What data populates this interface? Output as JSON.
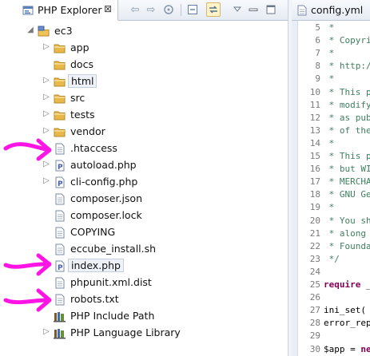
{
  "explorer": {
    "tab_title": "PHP Explorer",
    "close_glyph": "⊠",
    "toolbar_icons": [
      "back-icon",
      "forward-icon",
      "home-icon",
      "collapse-all-icon",
      "link-with-editor-icon",
      "view-menu-icon",
      "minimize-icon",
      "maximize-icon"
    ]
  },
  "tree": {
    "root": "ec3",
    "items": [
      {
        "label": "app",
        "kind": "folder"
      },
      {
        "label": "docs",
        "kind": "folder"
      },
      {
        "label": "html",
        "kind": "folder"
      },
      {
        "label": "src",
        "kind": "folder"
      },
      {
        "label": "tests",
        "kind": "folder"
      },
      {
        "label": "vendor",
        "kind": "folder"
      },
      {
        "label": ".htaccess",
        "kind": "file"
      },
      {
        "label": "autoload.php",
        "kind": "php"
      },
      {
        "label": "cli-config.php",
        "kind": "php"
      },
      {
        "label": "composer.json",
        "kind": "file"
      },
      {
        "label": "composer.lock",
        "kind": "file"
      },
      {
        "label": "COPYING",
        "kind": "file"
      },
      {
        "label": "eccube_install.sh",
        "kind": "file"
      },
      {
        "label": "index.php",
        "kind": "php"
      },
      {
        "label": "phpunit.xml.dist",
        "kind": "file"
      },
      {
        "label": "robots.txt",
        "kind": "file"
      },
      {
        "label": "PHP Include Path",
        "kind": "library"
      },
      {
        "label": "PHP Language Library",
        "kind": "library"
      }
    ]
  },
  "editor": {
    "tab_title": "config.yml",
    "lines": [
      {
        "n": "5",
        "text": " *",
        "type": "comment"
      },
      {
        "n": "6",
        "text": " * Copyri",
        "type": "comment"
      },
      {
        "n": "7",
        "text": " *",
        "type": "comment"
      },
      {
        "n": "8",
        "text": " * http:/",
        "type": "comment"
      },
      {
        "n": "9",
        "text": " *",
        "type": "comment"
      },
      {
        "n": "10",
        "text": " * This p",
        "type": "comment"
      },
      {
        "n": "11",
        "text": " * modify",
        "type": "comment"
      },
      {
        "n": "12",
        "text": " * as pub",
        "type": "comment"
      },
      {
        "n": "13",
        "text": " * of the",
        "type": "comment"
      },
      {
        "n": "14",
        "text": " *",
        "type": "comment"
      },
      {
        "n": "15",
        "text": " * This p",
        "type": "comment"
      },
      {
        "n": "16",
        "text": " * but WI",
        "type": "comment"
      },
      {
        "n": "17",
        "text": " * MERCHA",
        "type": "comment"
      },
      {
        "n": "18",
        "text": " * GNU Ge",
        "type": "comment"
      },
      {
        "n": "19",
        "text": " *",
        "type": "comment"
      },
      {
        "n": "20",
        "text": " * You sh",
        "type": "comment"
      },
      {
        "n": "21",
        "text": " * along",
        "type": "comment"
      },
      {
        "n": "22",
        "text": " * Founda",
        "type": "comment"
      },
      {
        "n": "23",
        "text": " */",
        "type": "comment"
      },
      {
        "n": "24",
        "text": "",
        "type": "plain"
      },
      {
        "n": "25",
        "text": "require _",
        "type": "require"
      },
      {
        "n": "26",
        "text": "",
        "type": "plain"
      },
      {
        "n": "27",
        "text": "ini_set(",
        "type": "plain"
      },
      {
        "n": "28",
        "text": "error_rep",
        "type": "plain"
      },
      {
        "n": "29",
        "text": "",
        "type": "plain"
      },
      {
        "n": "30",
        "text": "$app = ne",
        "type": "app"
      }
    ]
  },
  "annotations": {
    "arrow_color": "#ff14e6"
  },
  "colors": {
    "folder": "#e8b84a",
    "selection_border": "#c5cfdf",
    "comment": "#3f7f5f",
    "keyword": "#7f0055"
  }
}
